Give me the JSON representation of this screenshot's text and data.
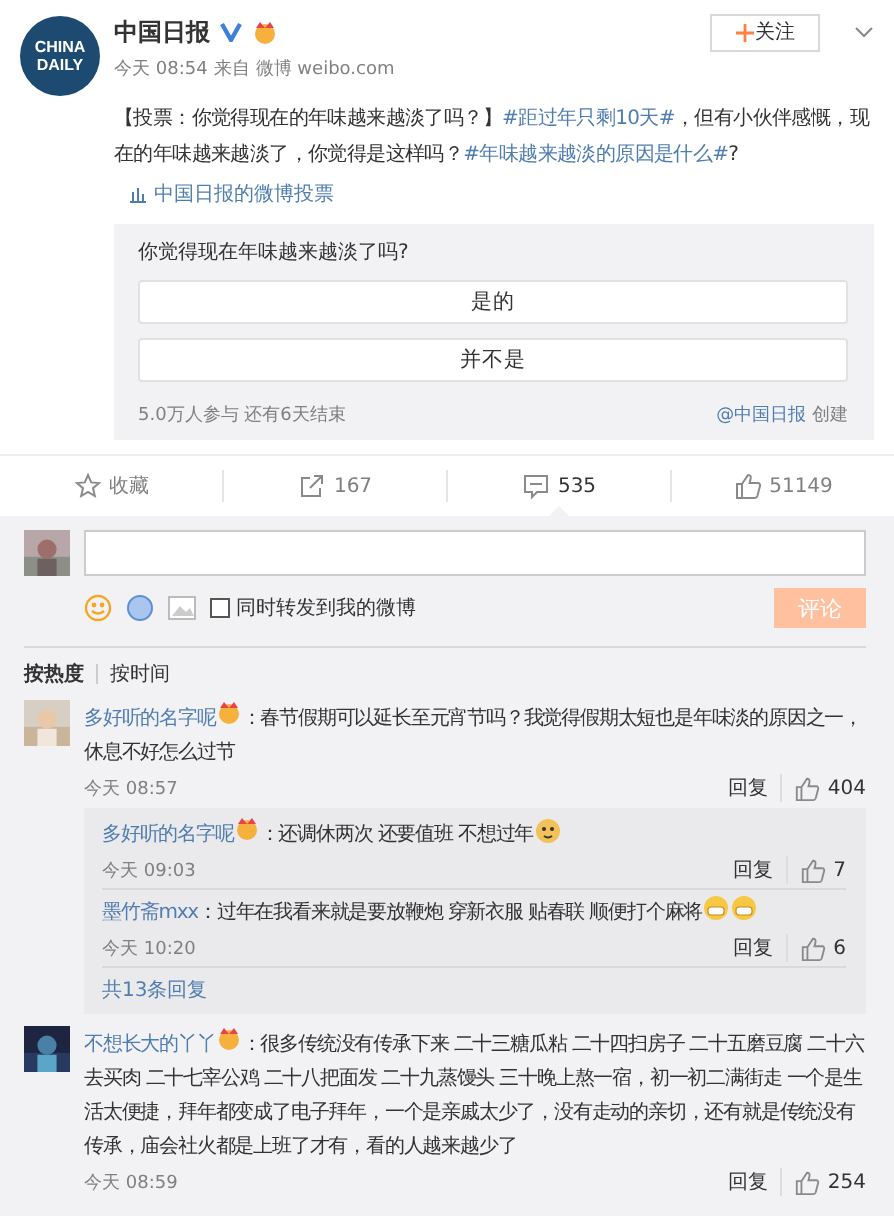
{
  "post": {
    "logo": [
      "CHINA",
      "DAILY"
    ],
    "author": "中国日报",
    "verified": true,
    "badge": true,
    "follow": "关注",
    "time": "今天 08:54",
    "source_prefix": "来自",
    "source": "微博 weibo.com",
    "text": [
      {
        "kind": "plain",
        "text": "【投票：你觉得现在的年味越来越淡了吗？】"
      },
      {
        "kind": "topic",
        "text": "#距过年只剩10天#"
      },
      {
        "kind": "plain",
        "text": "，但有小伙伴感慨，现在的年味越来越淡了，你觉得是这样吗？"
      },
      {
        "kind": "topic",
        "text": "#年味越来越淡的原因是什么#"
      },
      {
        "kind": "plain",
        "text": "?"
      }
    ],
    "vote_link": "中国日报的微博投票"
  },
  "poll": {
    "question": "你觉得现在年味越来越淡了吗?",
    "options": [
      "是的",
      "并不是"
    ],
    "stats": "5.0万人参与 还有6天结束",
    "creator": "@中国日报",
    "creator_suffix": "创建"
  },
  "actions": [
    {
      "kind": "favorite",
      "label": "收藏",
      "selected": false
    },
    {
      "kind": "repost",
      "label": "167",
      "selected": false
    },
    {
      "kind": "comment",
      "label": "535",
      "selected": true
    },
    {
      "kind": "like",
      "label": "51149",
      "selected": false
    }
  ],
  "composer": {
    "repost_label": "同时转发到我的微博",
    "repost_checked": false,
    "submit": "评论",
    "submit_disabled": true
  },
  "sort_tabs": [
    {
      "label": "按热度",
      "selected": true
    },
    {
      "label": "按时间",
      "selected": false
    }
  ],
  "comments": [
    {
      "author": "多好听的名字呢",
      "badge": true,
      "text": "：春节假期可以延长至元宵节吗？我觉得假期太短也是年味淡的原因之一，休息不好怎么过节",
      "time": "今天 08:57",
      "reply": "回复",
      "likes": "404",
      "replies": [
        {
          "author": "多好听的名字呢",
          "badge": true,
          "text": "：还调休两次 还要值班 不想过年",
          "emojis": [
            {
              "kind": "doge"
            }
          ],
          "time": "今天 09:03",
          "reply": "回复",
          "likes": "7"
        },
        {
          "author": "墨竹斋mxx",
          "badge": false,
          "text": "：过年在我看来就是要放鞭炮 穿新衣服 贴春联 顺便打个麻将",
          "emojis": [
            {
              "kind": "grin"
            },
            {
              "kind": "grin"
            }
          ],
          "time": "今天 10:20",
          "reply": "回复",
          "likes": "6"
        }
      ],
      "more": "共13条回复"
    },
    {
      "author": "不想长大的丫丫",
      "badge": true,
      "text": "：很多传统没有传承下来 二十三糖瓜粘 二十四扫房子 二十五磨豆腐 二十六去买肉 二十七宰公鸡 二十八把面发 二十九蒸馒头 三十晚上熬一宿，初一初二满街走 一个是生活太便捷，拜年都变成了电子拜年，一个是亲戚太少了，没有走动的亲切，还有就是传统没有传承，庙会社火都是上班了才有，看的人越来越少了",
      "time": "今天 08:59",
      "reply": "回复",
      "likes": "254"
    }
  ]
}
